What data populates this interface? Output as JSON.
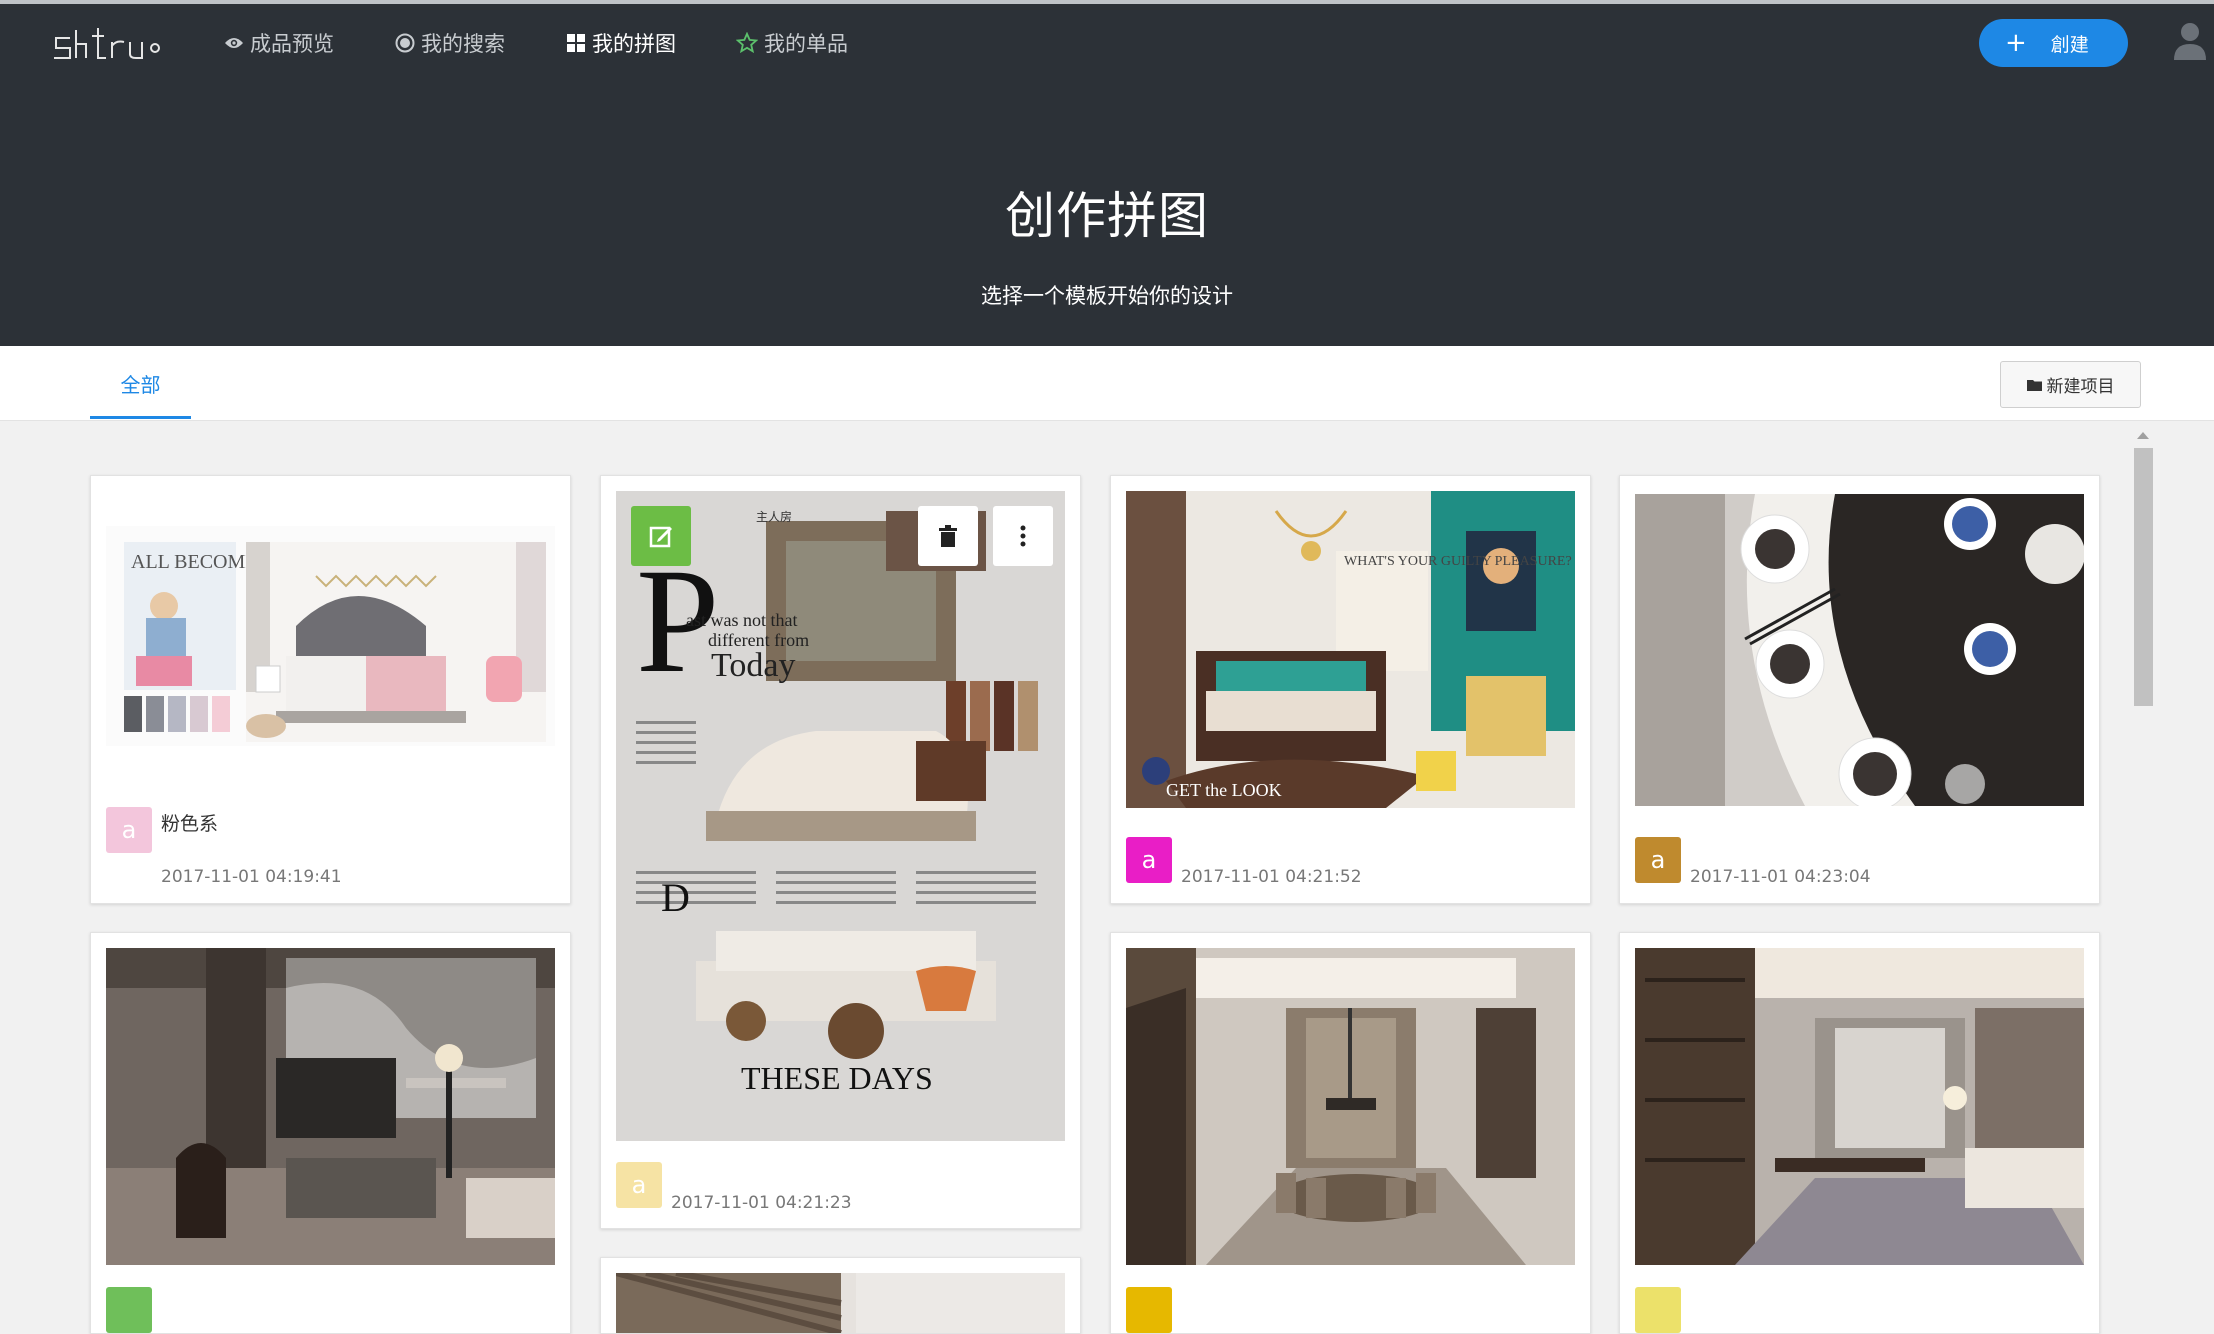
{
  "nav": {
    "logo_text": "shtru",
    "items": [
      {
        "label": "成品预览",
        "icon": "eye-icon"
      },
      {
        "label": "我的搜索",
        "icon": "target-icon"
      },
      {
        "label": "我的拼图",
        "icon": "grid-icon"
      },
      {
        "label": "我的单品",
        "icon": "star-outline-icon"
      }
    ],
    "active_item": "我的拼图",
    "create_label": "創建",
    "create_icon": "plus-icon",
    "user_icon": "user-icon"
  },
  "hero": {
    "title": "创作拼图",
    "subtitle": "选择一个模板开始你的设计"
  },
  "tabs": {
    "all_label": "全部",
    "new_project_label": "新建项目",
    "new_project_icon": "folder-icon"
  },
  "cards": [
    {
      "name": "粉色系",
      "date": "2017-11-01 04:19:41",
      "avatar_letter": "a",
      "avatar_color": "#f3c6dc"
    },
    {
      "name": "",
      "date": "2017-11-01 04:21:23",
      "avatar_letter": "a",
      "avatar_color": "#f6e3a4"
    },
    {
      "name": "",
      "date": "2017-11-01 04:21:52",
      "avatar_letter": "a",
      "avatar_color": "#e91ec6"
    },
    {
      "name": "",
      "date": "2017-11-01 04:23:04",
      "avatar_letter": "a",
      "avatar_color": "#bf8a2e"
    },
    {
      "name": "",
      "date": "",
      "avatar_letter": "",
      "avatar_color": "#6fbf5a"
    },
    {
      "name": "",
      "date": "",
      "avatar_letter": "",
      "avatar_color": "#e6b800"
    },
    {
      "name": "",
      "date": "",
      "avatar_letter": "",
      "avatar_color": "#ece16a"
    }
  ],
  "card_overlay": {
    "edit_icon": "edit-icon",
    "delete_icon": "trash-icon",
    "more_icon": "more-vertical-icon"
  },
  "moodboard_texts": {
    "card1_poster": "ALL BECOMES CLEAR",
    "card2_headline_1": "ast was not that",
    "card2_headline_2": "different from",
    "card2_headline_3": "Today",
    "card2_footer": "THESE DAYS",
    "card2_tag": "主人房",
    "card3_poster": "WHAT'S YOUR GUILTY PLEASURE?",
    "card3_footer": "GET the LOOK"
  },
  "colors": {
    "header_bg": "#2c3137",
    "accent": "#1e88e5",
    "page_bg": "#f1f1f1",
    "edit_green": "#6cbd45"
  }
}
